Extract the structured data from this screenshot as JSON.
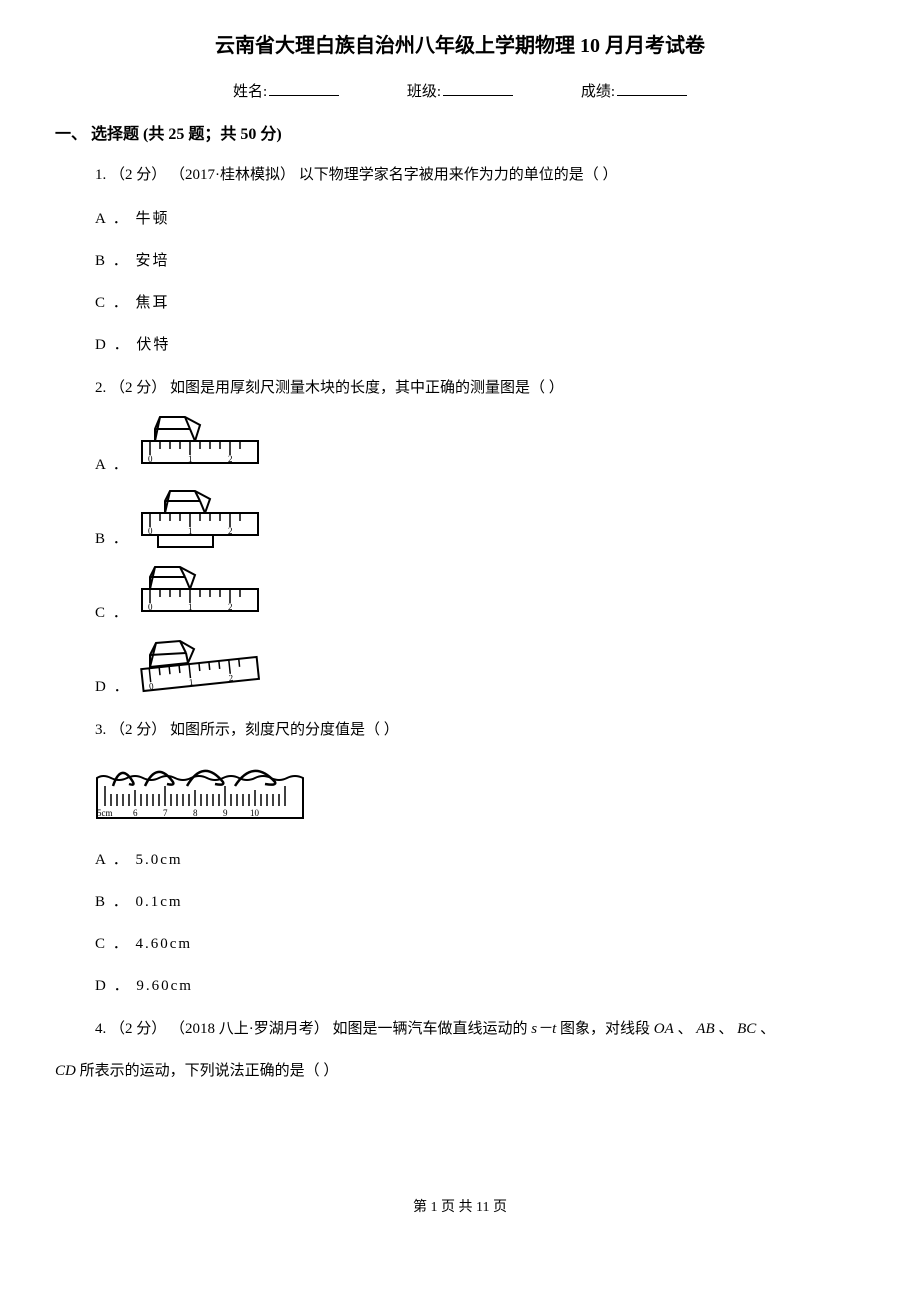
{
  "title": "云南省大理白族自治州八年级上学期物理 10 月月考试卷",
  "meta": {
    "name_label": "姓名:",
    "class_label": "班级:",
    "score_label": "成绩:"
  },
  "section": "一、 选择题 (共 25 题；共 50 分)",
  "q1": {
    "stem": "1.  （2 分） （2017·桂林模拟） 以下物理学家名字被用来作为力的单位的是（      ）",
    "a": "A ． 牛顿",
    "b": "B ． 安培",
    "c": "C ． 焦耳",
    "d": "D ． 伏特"
  },
  "q2": {
    "stem": "2.  （2 分）  如图是用厚刻尺测量木块的长度，其中正确的测量图是（      ）",
    "a": "A ．",
    "b": "B ．",
    "c": "C ．",
    "d": "D ．"
  },
  "q3": {
    "stem": "3.  （2 分）  如图所示，刻度尺的分度值是（      ）",
    "a": "A ． 5.0cm",
    "b": "B ． 0.1cm",
    "c": "C ． 4.60cm",
    "d": "D ． 9.60cm"
  },
  "q4": {
    "stem_part1": "4.  （2 分） （2018 八上·罗湖月考） 如图是一辆汽车做直线运动的 ",
    "stem_math": "s－t",
    "stem_part2": " 图象，对线段 ",
    "oa": "OA",
    "ab": "AB",
    "bc": "BC",
    "sep": " 、 ",
    "cd": "CD",
    "stem_part3": " 所表示的运动，下列说法正确的是（      ）"
  },
  "footer": {
    "prefix": "第 ",
    "current": "1",
    "mid": " 页 共 ",
    "total": "11",
    "suffix": " 页"
  }
}
